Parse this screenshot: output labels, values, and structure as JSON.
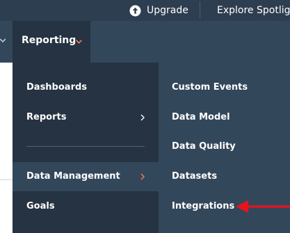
{
  "topbar": {
    "upgrade_label": "Upgrade",
    "explore_label": "Explore Spotlight"
  },
  "nav": {
    "active_label": "Reporting"
  },
  "menu": {
    "items": [
      {
        "label": "Dashboards",
        "has_submenu": false,
        "active": false
      },
      {
        "label": "Reports",
        "has_submenu": true,
        "active": false
      },
      {
        "label": "Data Management",
        "has_submenu": true,
        "active": true
      },
      {
        "label": "Goals",
        "has_submenu": false,
        "active": false
      }
    ]
  },
  "submenu": {
    "items": [
      {
        "label": "Custom Events"
      },
      {
        "label": "Data Model"
      },
      {
        "label": "Data Quality"
      },
      {
        "label": "Datasets"
      },
      {
        "label": "Integrations"
      }
    ]
  },
  "colors": {
    "topbar_bg": "#2d3e50",
    "nav_bg": "#33475b",
    "menu_bg": "#253342",
    "submenu_bg": "#33475b",
    "accent_chevron": "#ff7a59",
    "annotation_arrow": "#e8141c"
  },
  "icons": {
    "upgrade": "arrow-up-circle-icon",
    "submenu_chevron": "chevron-right-icon",
    "nav_chevron": "chevron-down-icon"
  }
}
